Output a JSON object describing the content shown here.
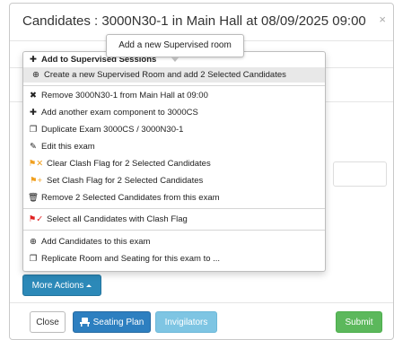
{
  "modal": {
    "title": "Candidates : 3000N30-1 in Main Hall at 08/09/2025 09:00",
    "close_glyph": "×"
  },
  "tooltip": {
    "text": "Add a new Supervised room"
  },
  "menu": {
    "items": [
      {
        "label": "Add to Supervised Sessions",
        "icon": "plus-icon",
        "glyph": "✚",
        "color": "#222222",
        "style": "header"
      },
      {
        "label": "Create a new Supervised Room and add 2 Selected Candidates",
        "icon": "plus-circle-icon",
        "glyph": "⊕",
        "color": "#222222",
        "style": "active"
      },
      {
        "label": "Remove 3000N30-1 from Main Hall at 09:00",
        "icon": "x-icon",
        "glyph": "✖",
        "color": "#222222",
        "style": "normal"
      },
      {
        "label": "Add another exam component to 3000CS",
        "icon": "plus-icon",
        "glyph": "✚",
        "color": "#222222",
        "style": "normal"
      },
      {
        "label": "Duplicate Exam 3000CS / 3000N30-1",
        "icon": "duplicate-icon",
        "glyph": "❐",
        "color": "#222222",
        "style": "normal"
      },
      {
        "label": "Edit this exam",
        "icon": "edit-icon",
        "glyph": "✎",
        "color": "#222222",
        "style": "normal"
      },
      {
        "label": "Clear Clash Flag for 2 Selected Candidates",
        "icon": "flag-clear-icon",
        "glyph": "⚑✕",
        "color": "#f0a020",
        "style": "normal"
      },
      {
        "label": "Set Clash Flag for 2 Selected Candidates",
        "icon": "flag-set-icon",
        "glyph": "⚑+",
        "color": "#f0a020",
        "style": "normal"
      },
      {
        "label": "Remove 2 Selected Candidates from this exam",
        "icon": "trash-icon",
        "glyph": "🗑",
        "color": "#333333",
        "style": "normal"
      },
      {
        "label": "Select all Candidates with Clash Flag",
        "icon": "flag-check-icon",
        "glyph": "⚑✓",
        "color": "#e02020",
        "style": "normal"
      },
      {
        "label": "Add Candidates to this exam",
        "icon": "plus-circle-icon",
        "glyph": "⊕",
        "color": "#222222",
        "style": "normal"
      },
      {
        "label": "Replicate Room and Seating for this exam to ...",
        "icon": "replicate-icon",
        "glyph": "❐",
        "color": "#222222",
        "style": "normal"
      }
    ]
  },
  "buttons": {
    "more_actions": "More Actions",
    "close": "Close",
    "seating_plan": "Seating Plan",
    "seating_icon": "seating-icon",
    "invigilators": "Invigilators",
    "submit": "Submit"
  }
}
